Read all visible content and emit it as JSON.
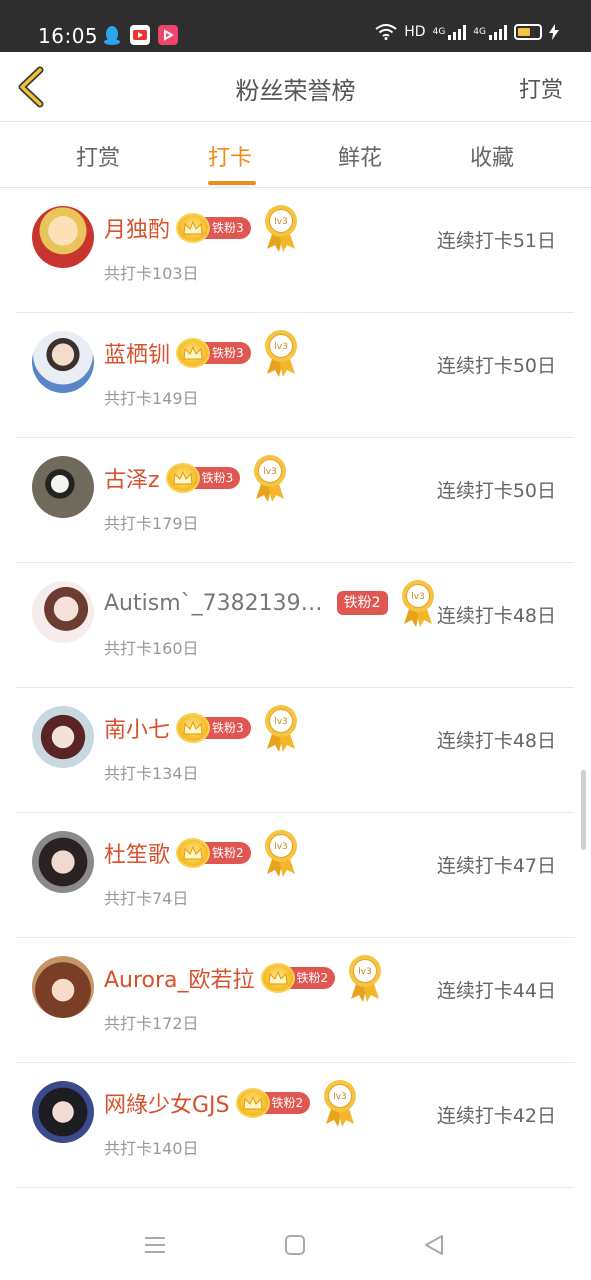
{
  "status_bar": {
    "time": "16:05",
    "network": "HD",
    "signal1": "4G",
    "signal2": "4G",
    "notification_icons": [
      "qq-icon",
      "video-app-icon",
      "play-app-icon"
    ]
  },
  "header": {
    "title": "粉丝荣誉榜",
    "action": "打赏"
  },
  "tabs": [
    {
      "label": "打赏",
      "active": false
    },
    {
      "label": "打卡",
      "active": true
    },
    {
      "label": "鲜花",
      "active": false
    },
    {
      "label": "收藏",
      "active": false
    }
  ],
  "colors": {
    "accent": "#ef8c18",
    "name_red": "#d9502d",
    "fan_tag": "#e05651"
  },
  "fans": [
    {
      "name": "月独酌",
      "fan_level": "铁粉3",
      "medal": "lv3",
      "total": "共打卡103日",
      "streak": "连续打卡51日"
    },
    {
      "name": "蓝栖钏",
      "fan_level": "铁粉3",
      "medal": "lv3",
      "total": "共打卡149日",
      "streak": "连续打卡50日"
    },
    {
      "name": "古泽z",
      "fan_level": "铁粉3",
      "medal": "lv3",
      "total": "共打卡179日",
      "streak": "连续打卡50日"
    },
    {
      "name": "Autism`_7382139…",
      "fan_level": "铁粉2",
      "medal": "lv3",
      "total": "共打卡160日",
      "streak": "连续打卡48日"
    },
    {
      "name": "南小七",
      "fan_level": "铁粉3",
      "medal": "lv3",
      "total": "共打卡134日",
      "streak": "连续打卡48日"
    },
    {
      "name": "杜笙歌",
      "fan_level": "铁粉2",
      "medal": "lv3",
      "total": "共打卡74日",
      "streak": "连续打卡47日"
    },
    {
      "name": "Aurora_欧若拉",
      "fan_level": "铁粉2",
      "medal": "lv3",
      "total": "共打卡172日",
      "streak": "连续打卡44日"
    },
    {
      "name": "网綠少女GJS",
      "fan_level": "铁粉2",
      "medal": "lv3",
      "total": "共打卡140日",
      "streak": "连续打卡42日"
    }
  ]
}
